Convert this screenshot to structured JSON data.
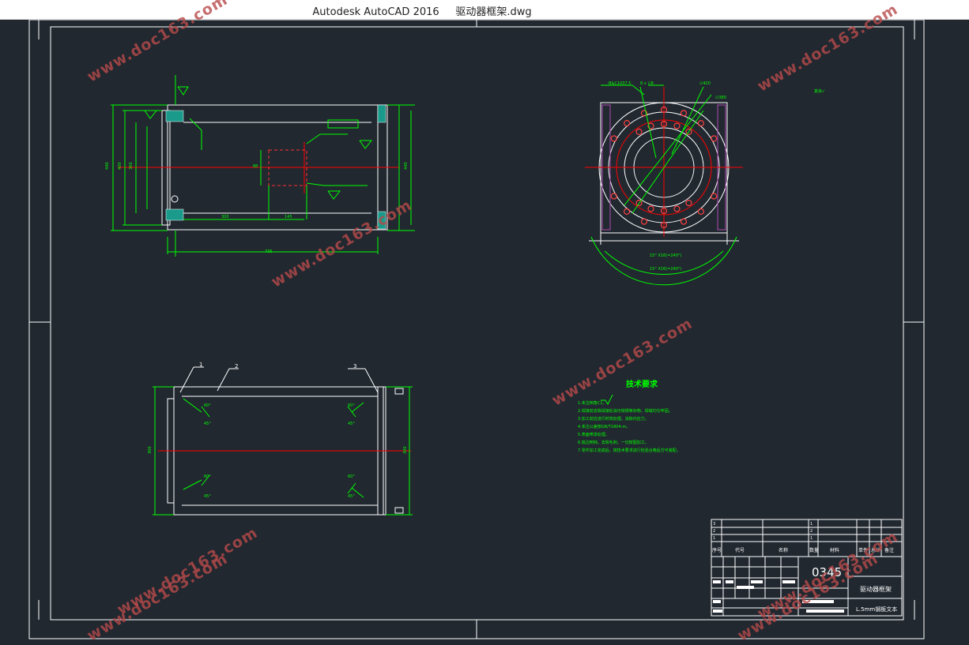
{
  "window": {
    "title": "Autodesk AutoCAD 2016     驱动器框架.dwg"
  },
  "watermark": "www.doc163.com",
  "colors": {
    "background": "#212830",
    "frame": "#ffffff",
    "dimension": "#00ff00",
    "centerline": "#ff0000",
    "hidden": "#b04ab0",
    "watermark": "#b84a4a"
  },
  "callouts": {
    "part1": "1",
    "part2": "2",
    "part3": "3"
  },
  "notes": {
    "heading": "技术要求",
    "lines": [
      "1.未注倒角C1。",
      "2.焊接前去除焊接处油污铁锈等杂物，焊缝均匀牢固。",
      "3.加工前应进行时效处理，消除内应力。",
      "4.未注公差按GB/T1804-m。",
      "5.表面喷漆处理。",
      "6.锐边倒钝，去除毛刺，一切按图加工。",
      "7.零件加工完成后，按技术要求进行检验合格后方可装配。"
    ]
  },
  "title_block": {
    "drawing_no": "0345",
    "name": "驱动器框架",
    "unit": "L.5mm钢板文本",
    "headers": [
      "序号",
      "代号",
      "名称",
      "数量",
      "材料",
      "单件",
      "总计",
      "备注"
    ]
  }
}
